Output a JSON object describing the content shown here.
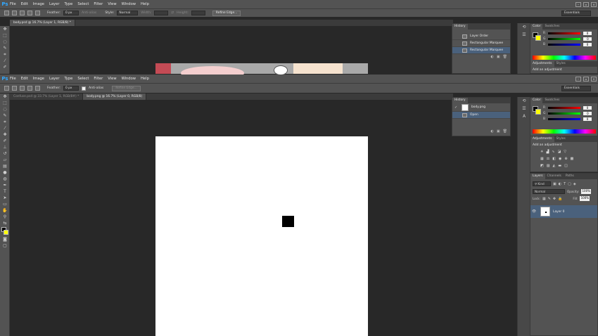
{
  "app": {
    "logo": "Ps"
  },
  "menu": [
    "File",
    "Edit",
    "Image",
    "Layer",
    "Type",
    "Select",
    "Filter",
    "View",
    "Window",
    "Help"
  ],
  "back": {
    "options": {
      "feather_label": "Feather:",
      "feather_value": "0 px",
      "antialias": "Anti-alias",
      "style_label": "Style:",
      "style_value": "Normal",
      "width_label": "Width:",
      "height_label": "Height:",
      "refine": "Refine Edge...",
      "workspace": "Essentials"
    },
    "tab": "body.psd @ 16.7% (Layer 1, RGB/8) *",
    "history": {
      "title": "History",
      "items": [
        "Layer Order",
        "Rectangular Marquee",
        "Rectangular Marquee"
      ]
    },
    "color": {
      "tabs": [
        "Color",
        "Swatches"
      ],
      "r": "0",
      "g": "0",
      "b": "0"
    },
    "adjustments": {
      "tabs": [
        "Adjustments",
        "Styles"
      ],
      "hint": "Add an adjustment"
    }
  },
  "front": {
    "options": {
      "feather_label": "Feather:",
      "feather_value": "0 px",
      "antialias": "Anti-alias",
      "refine": "Refine Edge...",
      "workspace": "Essentials"
    },
    "tabs": [
      "Confuse.psd @ 33.7% (Layer 1, RGB/8#) *",
      "body.png @ 16.7% (Layer 0, RGB/8)"
    ],
    "history": {
      "title": "History",
      "items": [
        "body.png",
        "Open"
      ]
    },
    "color": {
      "tabs": [
        "Color",
        "Swatches"
      ],
      "r": "0",
      "g": "0",
      "b": "0"
    },
    "adjustments": {
      "tabs": [
        "Adjustments",
        "Styles"
      ],
      "hint": "Add an adjustment"
    },
    "layers": {
      "tabs": [
        "Layers",
        "Channels",
        "Paths"
      ],
      "filter": "Kind",
      "blend": "Normal",
      "opacity_label": "Opacity:",
      "opacity": "100%",
      "lock_label": "Lock:",
      "fill_label": "Fill:",
      "fill": "100%",
      "layer_name": "Layer 0"
    }
  },
  "colors": {
    "accent": "#4a617c",
    "logo": "#31a8ff",
    "foreground": "#000000",
    "background": "#ffff00"
  },
  "icons": {
    "window_controls": [
      "minimize-icon",
      "restore-icon",
      "close-icon"
    ]
  }
}
